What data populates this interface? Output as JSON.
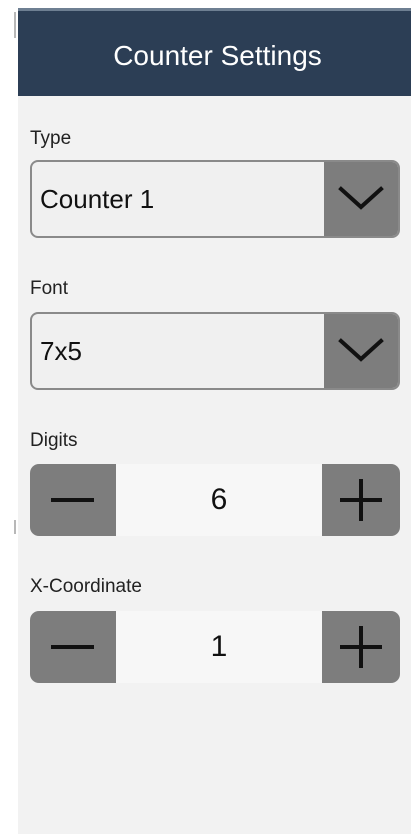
{
  "header": {
    "title": "Counter Settings"
  },
  "fields": {
    "type": {
      "label": "Type",
      "value": "Counter 1"
    },
    "font": {
      "label": "Font",
      "value": "7x5"
    },
    "digits": {
      "label": "Digits",
      "value": "6"
    },
    "x_coordinate": {
      "label": "X-Coordinate",
      "value": "1"
    }
  },
  "icons": {
    "dropdown": "chevron-down-icon",
    "decrement": "minus-icon",
    "increment": "plus-icon"
  },
  "colors": {
    "header_bg": "#2c3e55",
    "panel_bg": "#f2f2f2",
    "control_gray": "#7d7d7d"
  }
}
